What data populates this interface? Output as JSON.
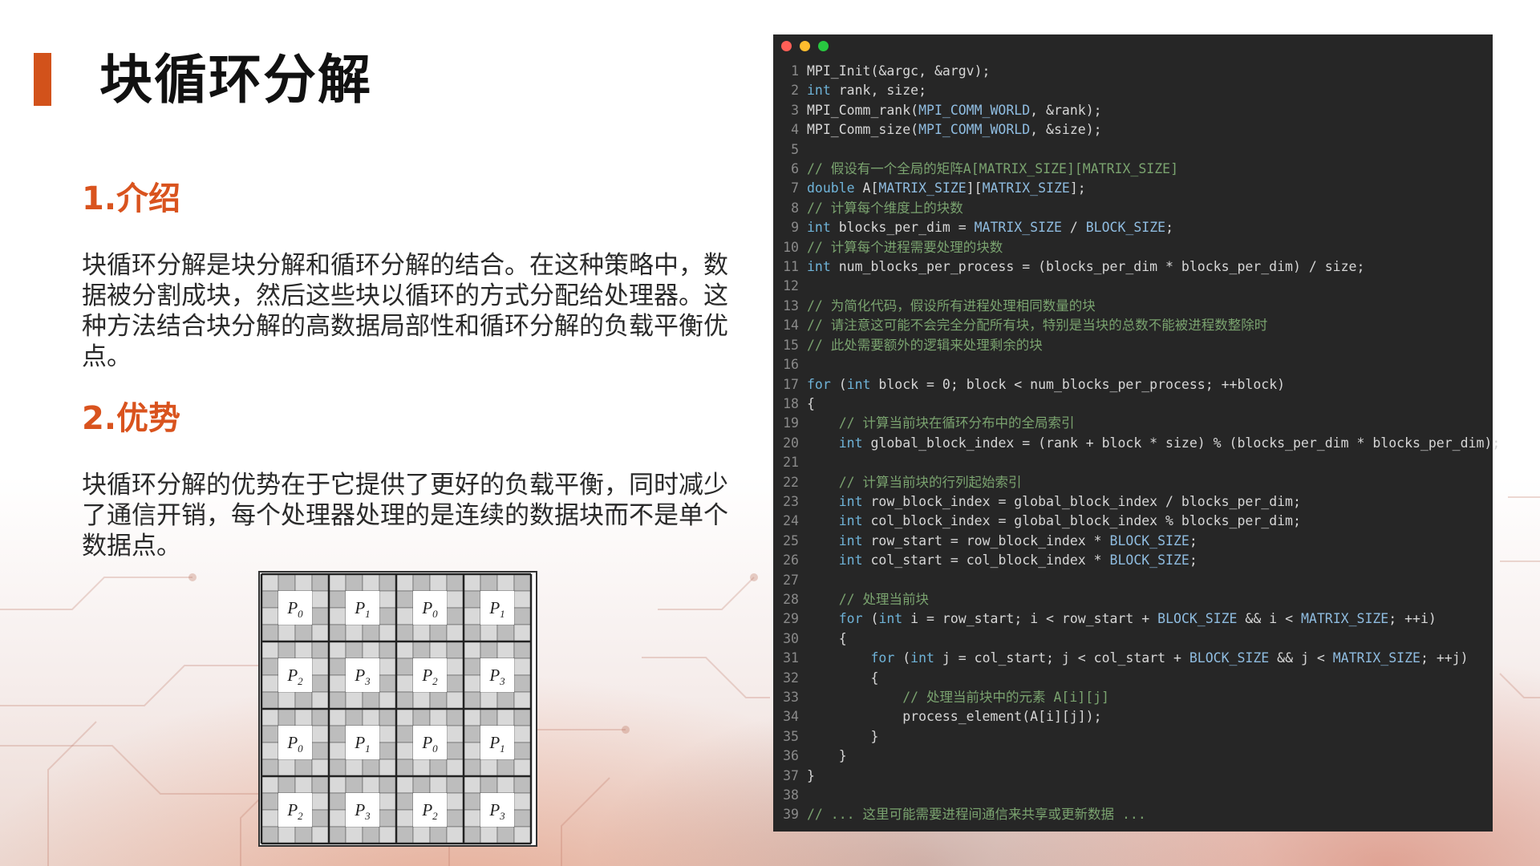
{
  "slide": {
    "title": "块循环分解",
    "section1_heading": "1.介绍",
    "section1_text": "块循环分解是块分解和循环分解的结合。在这种策略中，数据被分割成块，然后这些块以循环的方式分配给处理器。这种方法结合块分解的高数据局部性和循环分解的负载平衡优点。",
    "section2_heading": "2.优势",
    "section2_text": "块循环分解的优势在于它提供了更好的负载平衡，同时减少了通信开销，每个处理器处理的是连续的数据块而不是单个数据点。"
  },
  "figure": {
    "rows": [
      [
        "P0",
        "P1",
        "P0",
        "P1"
      ],
      [
        "P2",
        "P3",
        "P2",
        "P3"
      ],
      [
        "P0",
        "P1",
        "P0",
        "P1"
      ],
      [
        "P2",
        "P3",
        "P2",
        "P3"
      ]
    ]
  },
  "code_window": {
    "dot_colors": [
      "#ff5f57",
      "#febc2e",
      "#28c840"
    ],
    "lines": [
      "MPI_Init(&argc, &argv);",
      "int rank, size;",
      "MPI_Comm_rank(MPI_COMM_WORLD, &rank);",
      "MPI_Comm_size(MPI_COMM_WORLD, &size);",
      "",
      "// 假设有一个全局的矩阵A[MATRIX_SIZE][MATRIX_SIZE]",
      "double A[MATRIX_SIZE][MATRIX_SIZE];",
      "// 计算每个维度上的块数",
      "int blocks_per_dim = MATRIX_SIZE / BLOCK_SIZE;",
      "// 计算每个进程需要处理的块数",
      "int num_blocks_per_process = (blocks_per_dim * blocks_per_dim) / size;",
      "",
      "// 为简化代码，假设所有进程处理相同数量的块",
      "// 请注意这可能不会完全分配所有块，特别是当块的总数不能被进程数整除时",
      "// 此处需要额外的逻辑来处理剩余的块",
      "",
      "for (int block = 0; block < num_blocks_per_process; ++block)",
      "{",
      "    // 计算当前块在循环分布中的全局索引",
      "    int global_block_index = (rank + block * size) % (blocks_per_dim * blocks_per_dim);",
      "",
      "    // 计算当前块的行列起始索引",
      "    int row_block_index = global_block_index / blocks_per_dim;",
      "    int col_block_index = global_block_index % blocks_per_dim;",
      "    int row_start = row_block_index * BLOCK_SIZE;",
      "    int col_start = col_block_index * BLOCK_SIZE;",
      "",
      "    // 处理当前块",
      "    for (int i = row_start; i < row_start + BLOCK_SIZE && i < MATRIX_SIZE; ++i)",
      "    {",
      "        for (int j = col_start; j < col_start + BLOCK_SIZE && j < MATRIX_SIZE; ++j)",
      "        {",
      "            // 处理当前块中的元素 A[i][j]",
      "            process_element(A[i][j]);",
      "        }",
      "    }",
      "}",
      "",
      "// ... 这里可能需要进程间通信来共享或更新数据 ..."
    ]
  }
}
